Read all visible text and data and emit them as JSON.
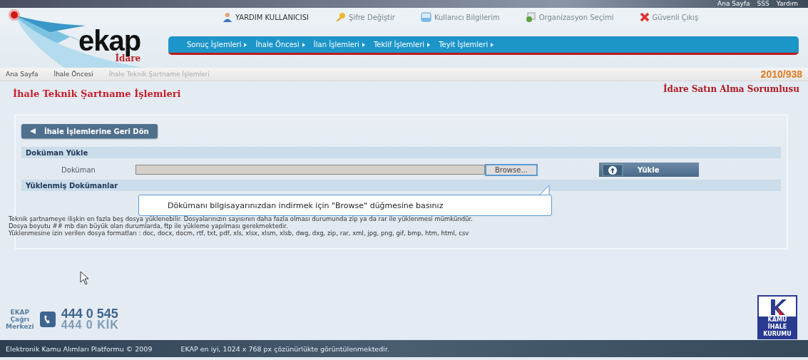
{
  "top_links": [
    "Ana Sayfa",
    "SSS",
    "Yardım"
  ],
  "user_links": [
    {
      "kind": "user",
      "label": "YARDIM KULLANICISI"
    },
    {
      "kind": "key",
      "label": "Şifre Değiştir"
    },
    {
      "kind": "doc",
      "label": "Kullanıcı Bilgilerim"
    },
    {
      "kind": "org",
      "label": "Organizasyon Seçimi"
    },
    {
      "kind": "exit",
      "label": "Güvenli Çıkış"
    }
  ],
  "logo": {
    "name": "ekap",
    "subtitle": "İdare"
  },
  "nav": [
    "Sonuç İşlemleri",
    "İhale Öncesi",
    "İlan İşlemleri",
    "Teklif İşlemleri",
    "Teyit İşlemleri"
  ],
  "breadcrumb": [
    "Ana Sayfa",
    "İhale Öncesi",
    "İhale Teknik Şartname İşlemleri"
  ],
  "record_no": "2010/938",
  "page_title": "İhale Teknik Şartname İşlemleri",
  "role": "İdare Satın Alma Sorumlusu",
  "back_button": "İhale İşlemlerine Geri Dön",
  "upload_section": {
    "title": "Doküman Yükle",
    "field_label": "Doküman",
    "browse_button": "Browse...",
    "upload_button": "Yükle"
  },
  "uploaded_section": {
    "title": "Yüklenmiş Dokümanlar"
  },
  "tooltip": "Dökümanı bilgisayarınızdan indirmek için \"Browse\" düğmesine basınız",
  "notes": [
    "Teknik şartnameye ilişkin en fazla beş dosya yüklenebilir. Dosyalarınızın sayısının daha fazla olması durumunda zip ya da rar ile yüklenmesi mümkündür.",
    "Dosya boyutu ## mb dan büyük olan durumlarda, ftp ile yükleme yapılması gerekmektedir.",
    "Yüklenmesine izin verilen dosya formatları : doc, docx, docm, rtf, txt, pdf, xls, xlsx, xlsm, xlsb, dwg, dxg, zip, rar, xml, jpg, png, gif, bmp, htm, html, csv"
  ],
  "call_center": {
    "label_lines": [
      "EKAP",
      "Çağrı",
      "Merkezi"
    ],
    "phone": "444 0 545",
    "phone_alt": "444 0 KİK"
  },
  "kik_logo": [
    "KAMU",
    "İHALE",
    "KURUMU"
  ],
  "footer": {
    "copyright": "Elektronik Kamu Alımları Platformu © 2009",
    "resolution_note": "EKAP en iyi, 1024 x 768 px çözünürlükte görüntülenmektedir."
  }
}
